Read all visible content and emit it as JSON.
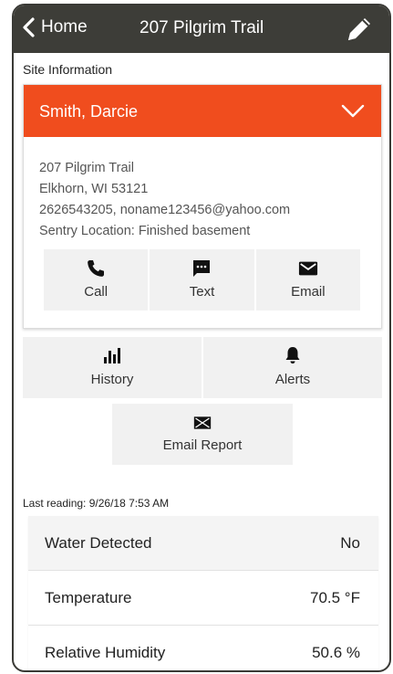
{
  "nav": {
    "back_label": "Home",
    "title": "207 Pilgrim Trail"
  },
  "site_info_label": "Site Information",
  "contact": {
    "name": "Smith, Darcie",
    "address_line1": "207 Pilgrim Trail",
    "address_line2": "Elkhorn, WI 53121",
    "phone_email": "2626543205, noname123456@yahoo.com",
    "sentry_location": "Sentry Location: Finished basement",
    "header_color": "#f04d1e",
    "actions": [
      {
        "label": "Call",
        "icon": "phone-icon"
      },
      {
        "label": "Text",
        "icon": "message-icon"
      },
      {
        "label": "Email",
        "icon": "envelope-icon"
      }
    ]
  },
  "site_actions": [
    {
      "label": "History",
      "icon": "bar-chart-icon"
    },
    {
      "label": "Alerts",
      "icon": "bell-icon"
    }
  ],
  "email_report": {
    "label": "Email Report",
    "icon": "envelope-icon"
  },
  "last_reading": "Last reading: 9/26/18 7:53 AM",
  "readings": [
    {
      "label": "Water Detected",
      "value": "No"
    },
    {
      "label": "Temperature",
      "value": "70.5 °F"
    },
    {
      "label": "Relative Humidity",
      "value": "50.6 %"
    }
  ]
}
